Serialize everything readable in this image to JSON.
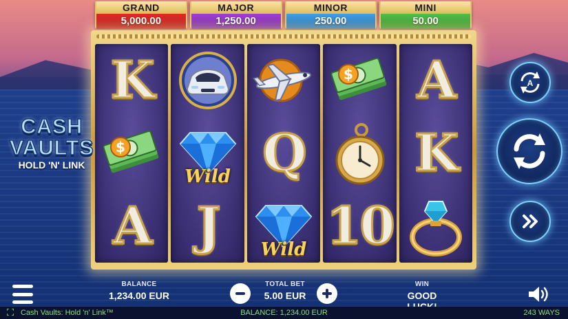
{
  "jackpots": [
    {
      "name": "GRAND",
      "value": "5,000.00",
      "color": "#c81e1c"
    },
    {
      "name": "MAJOR",
      "value": "1,250.00",
      "color": "#8a2cc0"
    },
    {
      "name": "MINOR",
      "value": "250.00",
      "color": "#2a86cc"
    },
    {
      "name": "MINI",
      "value": "50.00",
      "color": "#3ca636"
    }
  ],
  "logo": {
    "line1": "CASH",
    "line2": "VAULTS",
    "line3": "HOLD 'N' LINK"
  },
  "reels": [
    [
      {
        "symbol": "K",
        "icon": "letter-k-icon"
      },
      {
        "symbol": "cash",
        "icon": "cash-bundle-icon"
      },
      {
        "symbol": "A",
        "icon": "letter-a-icon"
      }
    ],
    [
      {
        "symbol": "car",
        "icon": "car-icon"
      },
      {
        "symbol": "Wild",
        "icon": "diamond-wild-icon"
      },
      {
        "symbol": "J",
        "icon": "letter-j-icon"
      }
    ],
    [
      {
        "symbol": "plane",
        "icon": "airplane-icon"
      },
      {
        "symbol": "Q",
        "icon": "letter-q-icon"
      },
      {
        "symbol": "Wild",
        "icon": "diamond-wild-icon"
      }
    ],
    [
      {
        "symbol": "cash",
        "icon": "cash-bundle-icon"
      },
      {
        "symbol": "watch",
        "icon": "pocket-watch-icon"
      },
      {
        "symbol": "10",
        "icon": "number-10-icon"
      }
    ],
    [
      {
        "symbol": "A",
        "icon": "letter-a-icon"
      },
      {
        "symbol": "K",
        "icon": "letter-k-icon"
      },
      {
        "symbol": "ring",
        "icon": "diamond-ring-icon"
      }
    ]
  ],
  "controls": {
    "autoplay_icon": "autoplay-icon",
    "autoplay_letter": "A",
    "spin_icon": "spin-icon",
    "turbo_icon": "fast-forward-icon"
  },
  "bottom": {
    "balance_label": "BALANCE",
    "balance_value": "1,234.00 EUR",
    "totalbet_label": "TOTAL BET",
    "totalbet_value": "5.00 EUR",
    "win_label": "WIN",
    "win_value": "GOOD LUCK!"
  },
  "status": {
    "title": "Cash Vaults: Hold 'n' Link™",
    "balance": "BALANCE: 1,234.00 EUR",
    "ways": "243 WAYS"
  },
  "wild_text": "Wild"
}
